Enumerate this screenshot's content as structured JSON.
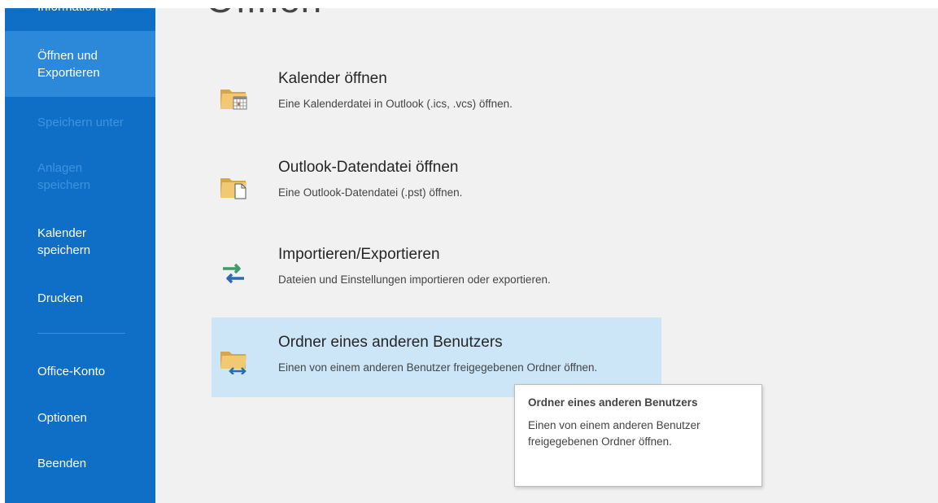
{
  "sidebar": {
    "items": [
      {
        "label": "Informationen"
      },
      {
        "label": "Öffnen und Exportieren"
      },
      {
        "label": "Speichern unter"
      },
      {
        "label": "Anlagen speichern"
      },
      {
        "label": "Kalender speichern"
      },
      {
        "label": "Drucken"
      },
      {
        "label": "Office-Konto"
      },
      {
        "label": "Optionen"
      },
      {
        "label": "Beenden"
      }
    ]
  },
  "main": {
    "title": "Öffnen",
    "items": [
      {
        "title": "Kalender öffnen",
        "desc": "Eine Kalenderdatei in Outlook (.ics, .vcs) öffnen.",
        "icon": "folder-calendar-icon"
      },
      {
        "title": "Outlook-Datendatei öffnen",
        "desc": "Eine Outlook-Datendatei (.pst) öffnen.",
        "icon": "folder-file-icon"
      },
      {
        "title": "Importieren/Exportieren",
        "desc": "Dateien und Einstellungen importieren oder exportieren.",
        "icon": "import-export-icon"
      },
      {
        "title": "Ordner eines anderen Benutzers",
        "desc": "Einen von einem anderen Benutzer freigegebenen Ordner öffnen.",
        "icon": "shared-folder-icon"
      }
    ]
  },
  "tooltip": {
    "title": "Ordner eines anderen Benutzers",
    "body": "Einen von einem anderen Benutzer freigegebenen Ordner öffnen."
  },
  "colors": {
    "sidebar_bg": "#0f6fc6",
    "sidebar_selected": "#2c88d9",
    "sidebar_disabled_text": "#3f92dc",
    "content_bg": "#f1f1f1",
    "item_highlight": "#cde6f7"
  }
}
